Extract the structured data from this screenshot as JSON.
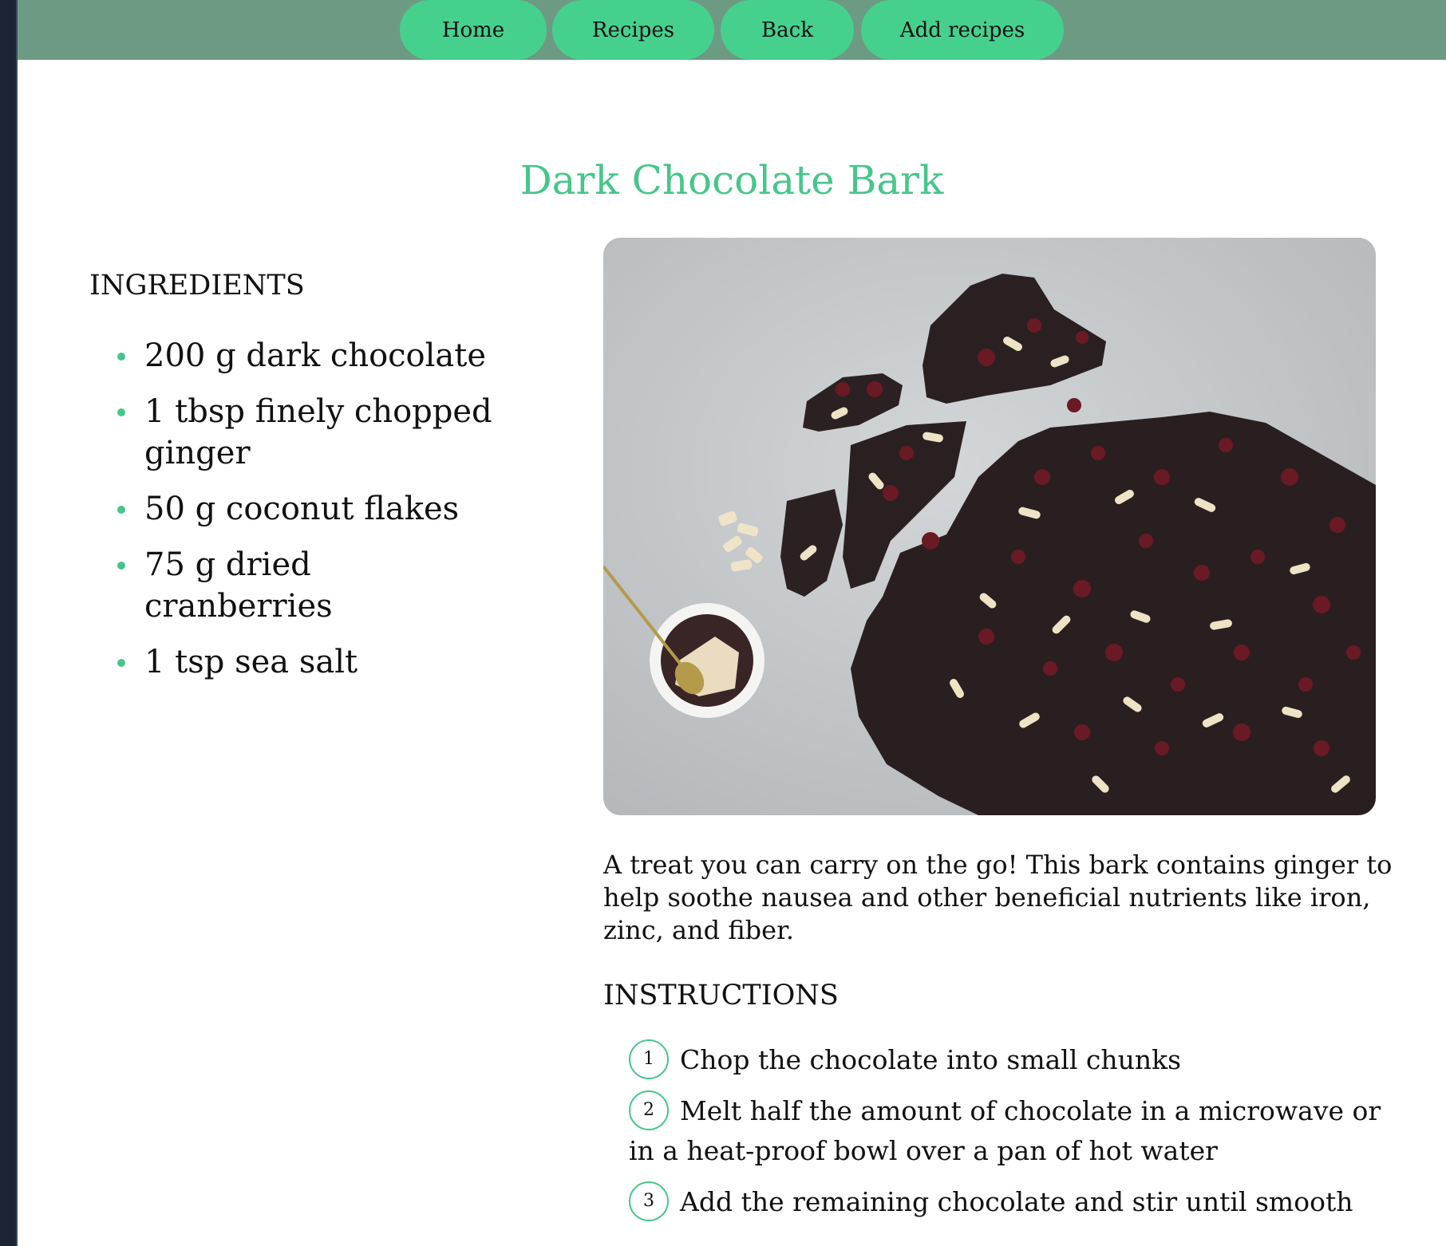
{
  "nav": {
    "home_label": "Home",
    "recipes_label": "Recipes",
    "back_label": "Back",
    "add_label": "Add recipes"
  },
  "recipe": {
    "title": "Dark Chocolate Bark",
    "ingredients_heading": "INGREDIENTS",
    "ingredients": [
      "200 g dark chocolate",
      "1 tbsp finely chopped ginger",
      "50 g coconut flakes",
      "75 g dried cranberries",
      "1 tsp sea salt"
    ],
    "description": "A treat you can carry on the go! This bark contains ginger to help soothe nausea and other beneficial nutrients like iron, zinc, and fiber.",
    "instructions_heading": "INSTRUCTIONS",
    "steps": [
      {
        "num": "1",
        "text": "Chop the chocolate into small chunks"
      },
      {
        "num": "2",
        "text": "Melt half the amount of chocolate in a microwave or in a heat-proof bowl over a pan of hot water"
      },
      {
        "num": "3",
        "text": "Add the remaining chocolate and stir until smooth"
      }
    ]
  },
  "colors": {
    "nav_bar": "#6d9a83",
    "nav_button": "#46d08e",
    "accent": "#46c68b"
  }
}
